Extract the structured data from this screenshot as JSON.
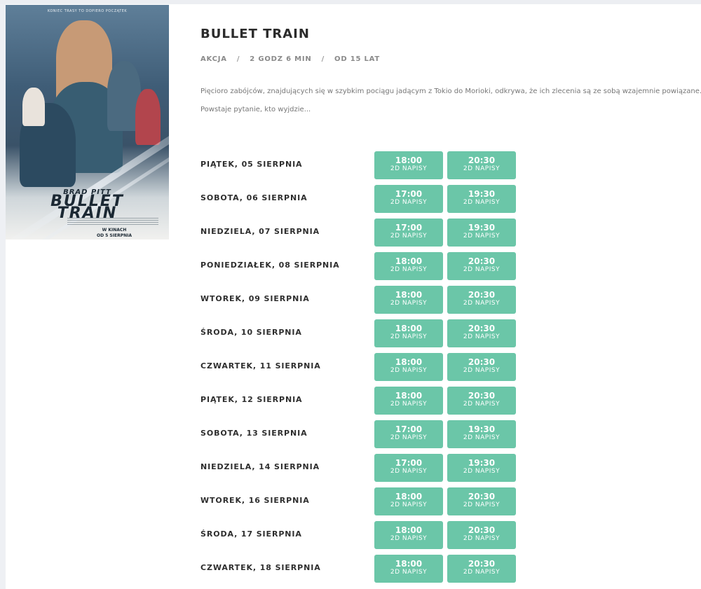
{
  "poster": {
    "tagline": "KONIEC TRASY TO DOPIERO POCZĄTEK",
    "star": "BRAD PITT",
    "title_line1": "BULLET",
    "title_line2": "TRAIN",
    "release_line1": "W KINACH",
    "release_line2": "OD 5 SIERPNIA"
  },
  "movie": {
    "title": "BULLET TRAIN",
    "genre": "AKCJA",
    "duration": "2 GODZ 6 MIN",
    "age": "OD 15 LAT",
    "separator": "/",
    "description_line1": "Pięcioro zabójców, znajdujących się w szybkim pociągu jadącym z Tokio do Morioki, odkrywa, że ich zlecenia są ze sobą wzajemnie powiązane.",
    "description_line2": "Powstaje pytanie, kto wyjdzie..."
  },
  "schedule": [
    {
      "day": "PIĄTEK, 05 SIERPNIA",
      "shows": [
        {
          "time": "18:00",
          "format": "2D NAPISY"
        },
        {
          "time": "20:30",
          "format": "2D NAPISY"
        }
      ]
    },
    {
      "day": "SOBOTA, 06 SIERPNIA",
      "shows": [
        {
          "time": "17:00",
          "format": "2D NAPISY"
        },
        {
          "time": "19:30",
          "format": "2D NAPISY"
        }
      ]
    },
    {
      "day": "NIEDZIELA, 07 SIERPNIA",
      "shows": [
        {
          "time": "17:00",
          "format": "2D NAPISY"
        },
        {
          "time": "19:30",
          "format": "2D NAPISY"
        }
      ]
    },
    {
      "day": "PONIEDZIAŁEK, 08 SIERPNIA",
      "shows": [
        {
          "time": "18:00",
          "format": "2D NAPISY"
        },
        {
          "time": "20:30",
          "format": "2D NAPISY"
        }
      ]
    },
    {
      "day": "WTOREK, 09 SIERPNIA",
      "shows": [
        {
          "time": "18:00",
          "format": "2D NAPISY"
        },
        {
          "time": "20:30",
          "format": "2D NAPISY"
        }
      ]
    },
    {
      "day": "ŚRODA, 10 SIERPNIA",
      "shows": [
        {
          "time": "18:00",
          "format": "2D NAPISY"
        },
        {
          "time": "20:30",
          "format": "2D NAPISY"
        }
      ]
    },
    {
      "day": "CZWARTEK, 11 SIERPNIA",
      "shows": [
        {
          "time": "18:00",
          "format": "2D NAPISY"
        },
        {
          "time": "20:30",
          "format": "2D NAPISY"
        }
      ]
    },
    {
      "day": "PIĄTEK, 12 SIERPNIA",
      "shows": [
        {
          "time": "18:00",
          "format": "2D NAPISY"
        },
        {
          "time": "20:30",
          "format": "2D NAPISY"
        }
      ]
    },
    {
      "day": "SOBOTA, 13 SIERPNIA",
      "shows": [
        {
          "time": "17:00",
          "format": "2D NAPISY"
        },
        {
          "time": "19:30",
          "format": "2D NAPISY"
        }
      ]
    },
    {
      "day": "NIEDZIELA, 14 SIERPNIA",
      "shows": [
        {
          "time": "17:00",
          "format": "2D NAPISY"
        },
        {
          "time": "19:30",
          "format": "2D NAPISY"
        }
      ]
    },
    {
      "day": "WTOREK, 16 SIERPNIA",
      "shows": [
        {
          "time": "18:00",
          "format": "2D NAPISY"
        },
        {
          "time": "20:30",
          "format": "2D NAPISY"
        }
      ]
    },
    {
      "day": "ŚRODA, 17 SIERPNIA",
      "shows": [
        {
          "time": "18:00",
          "format": "2D NAPISY"
        },
        {
          "time": "20:30",
          "format": "2D NAPISY"
        }
      ]
    },
    {
      "day": "CZWARTEK, 18 SIERPNIA",
      "shows": [
        {
          "time": "18:00",
          "format": "2D NAPISY"
        },
        {
          "time": "20:30",
          "format": "2D NAPISY"
        }
      ]
    }
  ]
}
